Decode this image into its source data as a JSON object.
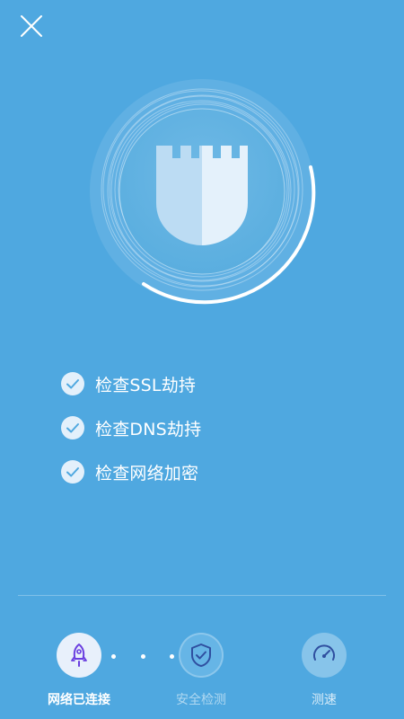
{
  "colors": {
    "background": "#4fa8e0",
    "active_step": "#6a3fe0",
    "step_inactive": "#66b5e6"
  },
  "header": {
    "close_icon": "close-icon"
  },
  "scan": {
    "icon": "castle-shield-icon",
    "progress": 0.5
  },
  "checks": [
    {
      "label": "检查SSL劫持",
      "icon": "checkmark-icon"
    },
    {
      "label": "检查DNS劫持",
      "icon": "checkmark-icon"
    },
    {
      "label": "检查网络加密",
      "icon": "checkmark-icon"
    }
  ],
  "steps": [
    {
      "label": "网络已连接",
      "icon": "rocket-icon"
    },
    {
      "label": "安全检测",
      "icon": "shield-check-icon"
    },
    {
      "label": "测速",
      "icon": "speedometer-icon"
    }
  ]
}
